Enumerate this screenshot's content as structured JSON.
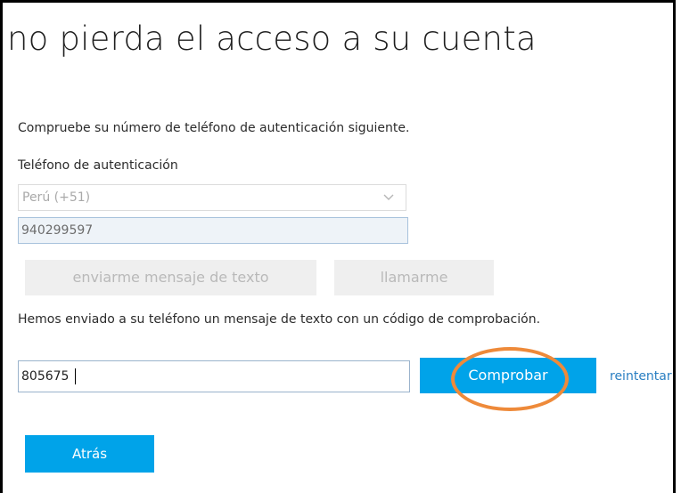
{
  "page": {
    "title": "no pierda el acceso a su cuenta",
    "instructions": "Compruebe su número de teléfono de autenticación siguiente.",
    "phone_label": "Teléfono de autenticación"
  },
  "country_select": {
    "selected": "Perú (+51)"
  },
  "phone_field": {
    "value": "940299597"
  },
  "contact_buttons": {
    "text_label": "enviarme mensaje de texto",
    "call_label": "llamarme"
  },
  "status_message": "Hemos enviado a su teléfono un mensaje de texto con un código de comprobación.",
  "code_field": {
    "value": "805675"
  },
  "verify_button": {
    "label": "Comprobar"
  },
  "retry_link": "reintentar",
  "back_button": {
    "label": "Atrás"
  },
  "colors": {
    "accent": "#00a3e9",
    "link": "#2a7fc2",
    "highlight": "#ee8a3a",
    "disabled_button": "#efefef",
    "frame_border": "#000000"
  },
  "icons": {
    "select_chevron": "chevron-down-icon"
  }
}
